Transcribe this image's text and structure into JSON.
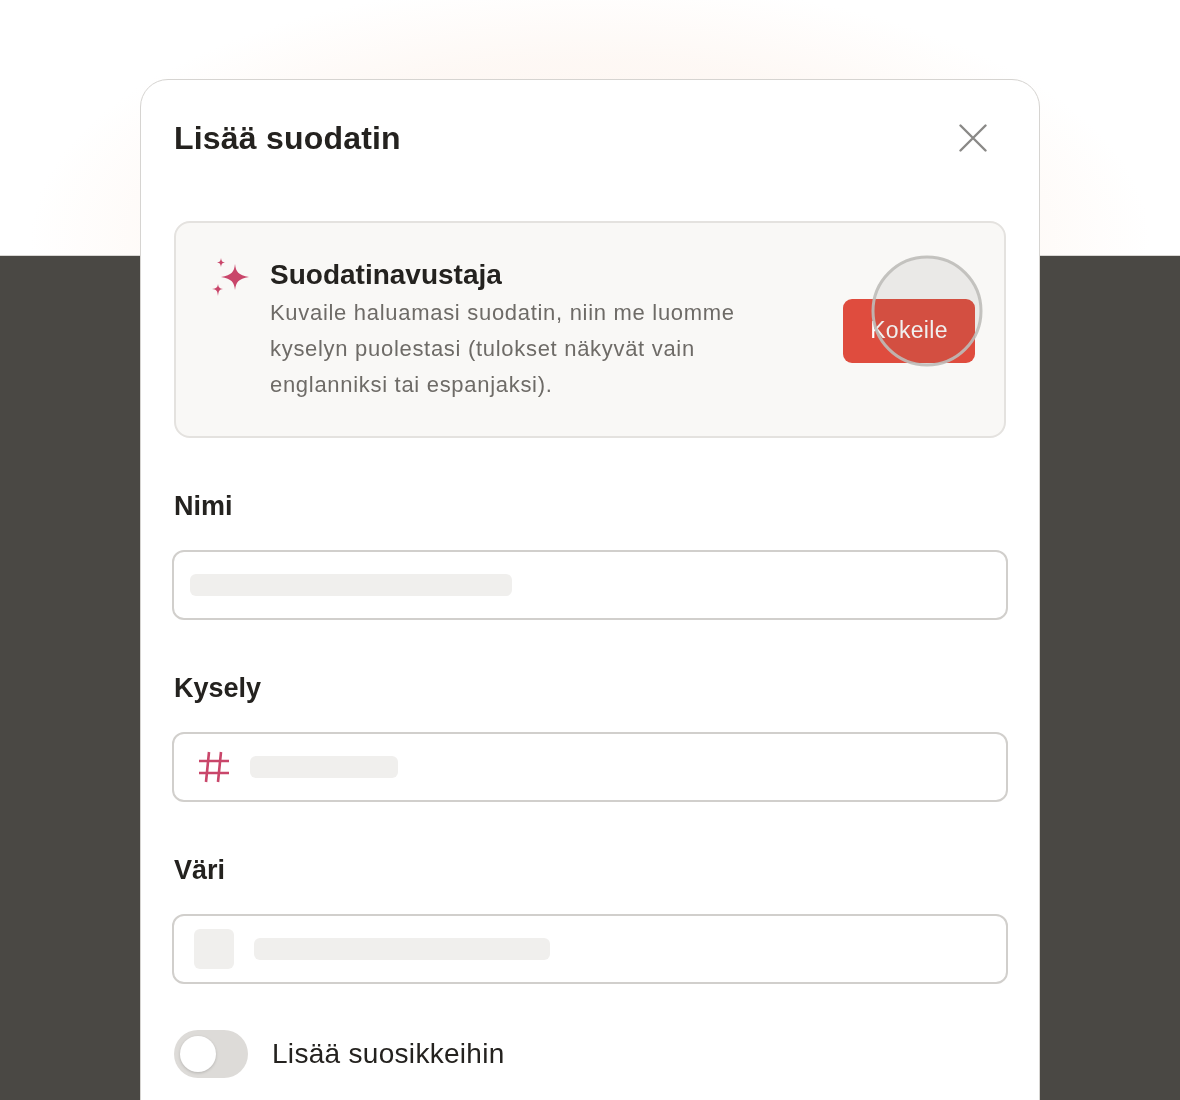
{
  "dialog": {
    "title": "Lisää suodatin"
  },
  "assistant": {
    "title": "Suodatinavustaja",
    "description": "Kuvaile haluamasi suodatin, niin me luomme kyselyn puolestasi (tulokset näkyvät vain englanniksi tai espanjaksi).",
    "button": "Kokeile"
  },
  "fields": [
    {
      "kind": "text",
      "label": "Nimi"
    },
    {
      "kind": "query",
      "label": "Kysely"
    },
    {
      "kind": "color",
      "label": "Väri"
    }
  ],
  "toggle": {
    "label": "Lisää suosikkeihin",
    "on": false
  }
}
